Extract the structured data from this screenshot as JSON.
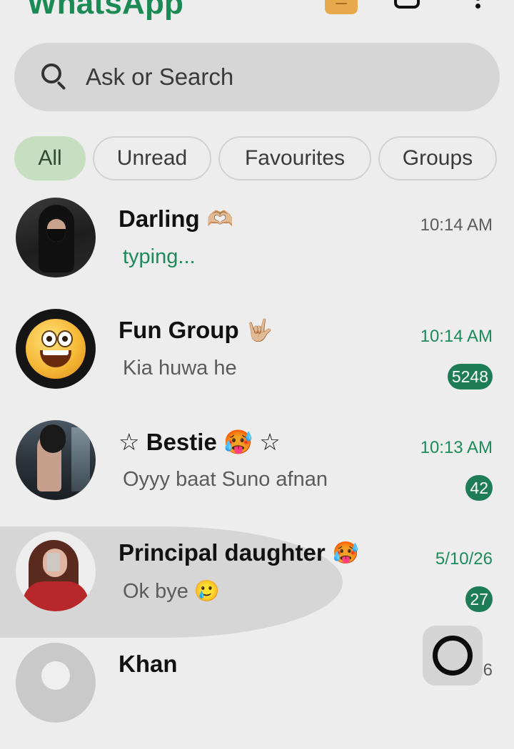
{
  "app": {
    "title": "WhatsApp"
  },
  "icons": {
    "meta_ai": "meta-ai-icon",
    "camera": "camera-icon",
    "menu": "more-vertical-icon",
    "search": "search-icon",
    "fab": "new-chat-icon"
  },
  "colors": {
    "brand_green": "#1b8a55",
    "unread_green": "#1e7d57",
    "chip_active_bg": "#c6dfc0"
  },
  "search": {
    "placeholder": "Ask or Search"
  },
  "filters": [
    {
      "label": "All",
      "active": true
    },
    {
      "label": "Unread",
      "active": false
    },
    {
      "label": "Favourites",
      "active": false
    },
    {
      "label": "Groups",
      "active": false
    }
  ],
  "chats": [
    {
      "name": "Darling",
      "name_emoji": "🫶🏼",
      "preview": "typing...",
      "time": "10:14 AM",
      "unread": ""
    },
    {
      "name": "Fun Group",
      "name_emoji": "🤟🏼",
      "preview": "Kia huwa he",
      "time": "10:14 AM",
      "unread": "5248"
    },
    {
      "name": "☆ Bestie 🥵 ☆",
      "name_emoji": "",
      "preview": "Oyyy baat Suno afnan",
      "time": "10:13 AM",
      "unread": "42"
    },
    {
      "name": "Principal daughter",
      "name_emoji": "🥵",
      "preview": "Ok bye 🥲",
      "time": "5/10/26",
      "unread": "27"
    },
    {
      "name": "Khan",
      "name_emoji": "",
      "preview": "",
      "time": "26",
      "unread": ""
    }
  ]
}
